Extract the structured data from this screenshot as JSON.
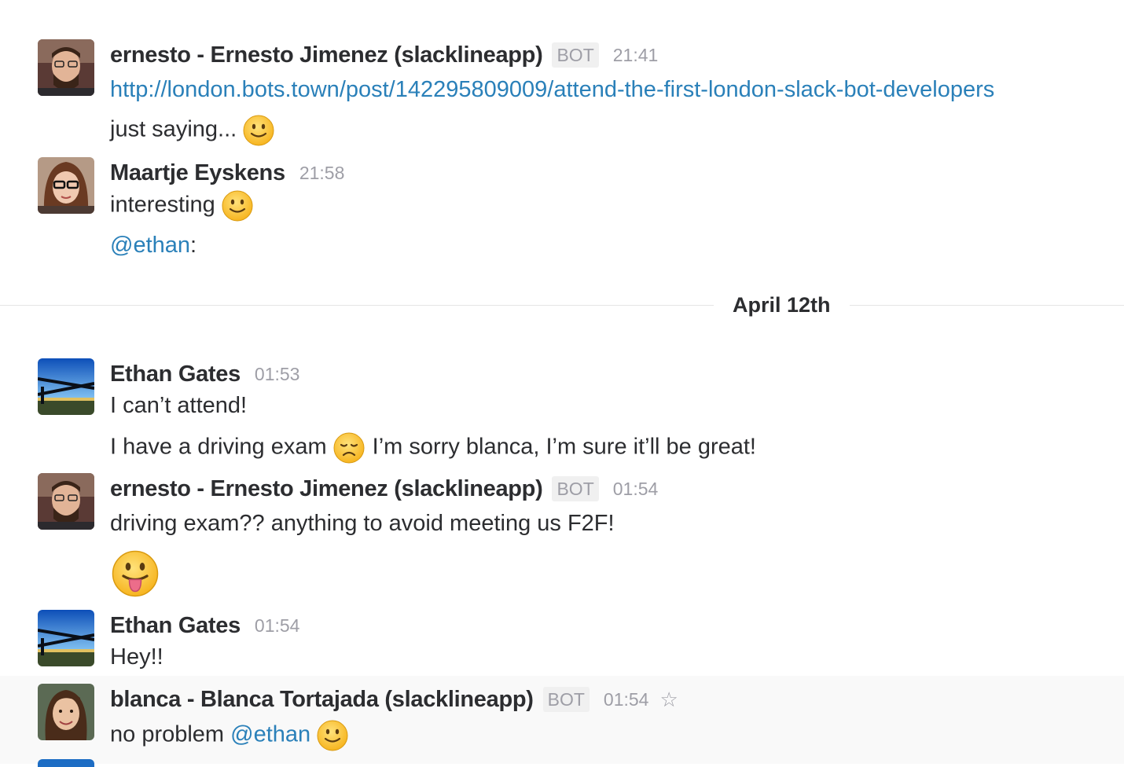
{
  "messages": [
    {
      "author": "ernesto - Ernesto Jimenez (slacklineapp)",
      "bot_badge": "BOT",
      "time": "21:41",
      "lines": [
        {
          "link": "http://london.bots.town/post/142295809009/attend-the-first-london-slack-bot-developers"
        },
        {
          "text": "just saying...",
          "emoji": "slightly-smiling-face"
        }
      ]
    },
    {
      "author": "Maartje Eyskens",
      "time": "21:58",
      "lines": [
        {
          "text": "interesting",
          "emoji": "slightly-smiling-face"
        },
        {
          "mention": "@ethan",
          "suffix": ":"
        }
      ]
    },
    {
      "author": "Ethan Gates",
      "time": "01:53",
      "lines": [
        {
          "text": "I can’t attend!"
        },
        {
          "text": "I have a driving exam",
          "emoji": "disappointed-face",
          "after": "I’m sorry blanca, I’m sure it’ll be great!"
        }
      ]
    },
    {
      "author": "ernesto - Ernesto Jimenez (slacklineapp)",
      "bot_badge": "BOT",
      "time": "01:54",
      "lines": [
        {
          "text": "driving exam?? anything to avoid meeting us F2F!"
        },
        {
          "emoji": "face-with-tongue"
        }
      ]
    },
    {
      "author": "Ethan Gates",
      "time": "01:54",
      "lines": [
        {
          "text": "Hey!!"
        }
      ]
    },
    {
      "author": "blanca - Blanca Tortajada (slacklineapp)",
      "bot_badge": "BOT",
      "time": "01:54",
      "icon": "star-icon",
      "lines": [
        {
          "text": "no problem",
          "mention": "@ethan",
          "emoji": "slightly-smiling-face"
        }
      ]
    }
  ],
  "date_divider": "April 12th",
  "colors": {
    "link": "#2a80b9",
    "muted": "#9e9ea6",
    "text": "#2c2d30",
    "hover_row": "#f9f9f9"
  }
}
